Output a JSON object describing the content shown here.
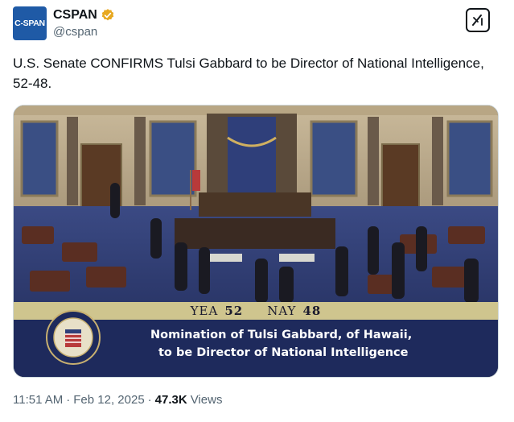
{
  "account": {
    "display_name": "CSPAN",
    "handle": "@cspan",
    "avatar_text": "C-SPAN",
    "verified_color": "#e7a820",
    "avatar_color": "#1f5aa6"
  },
  "tweet": {
    "text": "U.S. Senate CONFIRMS Tulsi Gabbard to be Director of National Intelligence, 52-48."
  },
  "media": {
    "vote": {
      "yea_label": "YEA",
      "yea_count": "52",
      "nay_label": "NAY",
      "nay_count": "48"
    },
    "caption_line1": "Nomination of Tulsi Gabbard, of Hawaii,",
    "caption_line2": "to be Director of National Intelligence",
    "seal_text": "UNITED STATES SENATE"
  },
  "meta": {
    "time": "11:51 AM",
    "separator": "·",
    "date": "Feb 12, 2025",
    "views_count": "47.3K",
    "views_label": "Views"
  },
  "icons": {
    "verified": "verified-badge-icon",
    "grok": "grok-icon"
  }
}
